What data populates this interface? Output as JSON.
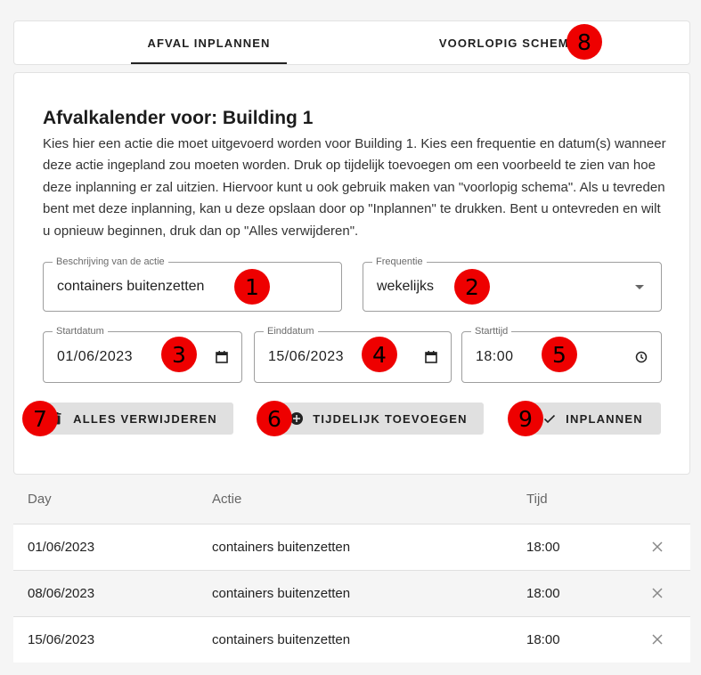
{
  "tabs": [
    {
      "label": "AFVAL INPLANNEN",
      "active": true
    },
    {
      "label": "VOORLOPIG SCHEMA",
      "active": false
    }
  ],
  "card": {
    "title": "Afvalkalender voor: Building 1",
    "description": "Kies hier een actie die moet uitgevoerd worden voor Building 1. Kies een frequentie en datum(s) wanneer deze actie ingepland zou moeten worden. Druk op tijdelijk toevoegen om een voorbeeld te zien van hoe deze inplanning er zal uitzien. Hiervoor kunt u ook gebruik maken van \"voorlopig schema\". Als u tevreden bent met deze inplanning, kan u deze opslaan door op \"Inplannen\" te drukken. Bent u ontevreden en wilt u opnieuw beginnen, druk dan op \"Alles verwijderen\"."
  },
  "form": {
    "description": {
      "label": "Beschrijving van de actie",
      "value": "containers buitenzetten"
    },
    "frequency": {
      "label": "Frequentie",
      "value": "wekelijks",
      "icon": "chevron-down-icon"
    },
    "start_date": {
      "label": "Startdatum",
      "value": "01/06/2023",
      "icon": "calendar-icon"
    },
    "end_date": {
      "label": "Einddatum",
      "value": "15/06/2023",
      "icon": "calendar-icon"
    },
    "start_time": {
      "label": "Starttijd",
      "value": "18:00",
      "icon": "clock-icon"
    }
  },
  "buttons": {
    "delete_all": {
      "label": "ALLES VERWIJDEREN",
      "icon": "trash-icon"
    },
    "add_temp": {
      "label": "TIJDELIJK TOEVOEGEN",
      "icon": "add-circle-icon"
    },
    "schedule": {
      "label": "INPLANNEN",
      "icon": "check-icon"
    }
  },
  "markers": [
    "1",
    "2",
    "3",
    "4",
    "5",
    "6",
    "7",
    "8",
    "9"
  ],
  "table": {
    "headers": [
      "Day",
      "Actie",
      "Tijd"
    ],
    "rows": [
      {
        "day": "01/06/2023",
        "action": "containers buitenzetten",
        "time": "18:00"
      },
      {
        "day": "08/06/2023",
        "action": "containers buitenzetten",
        "time": "18:00"
      },
      {
        "day": "15/06/2023",
        "action": "containers buitenzetten",
        "time": "18:00"
      }
    ]
  },
  "colors": {
    "marker": "#ee0000",
    "button_bg": "#e0e0e0",
    "tab_indicator": "#222222"
  }
}
